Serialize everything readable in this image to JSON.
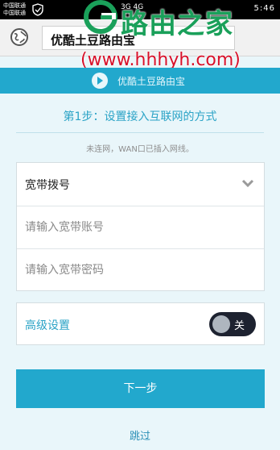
{
  "status_bar": {
    "carrier_1": "中国联通",
    "carrier_2": "中国联通",
    "signal_text": "3G 4G",
    "time_partial": "5:46"
  },
  "browser": {
    "url_text": "优酷土豆路由宝"
  },
  "watermark": {
    "title": "路由之家",
    "url": "(www.hhhyh.com)"
  },
  "header": {
    "title": "优酷土豆路由宝"
  },
  "step": {
    "title": "第1步：设置接入互联网的方式",
    "notice": "未连网，WAN口已插入网线。"
  },
  "form": {
    "connection_type": "宽带拨号",
    "account_placeholder": "请输入宽带账号",
    "password_placeholder": "请输入宽带密码"
  },
  "advanced": {
    "label": "高级设置",
    "toggle_text": "关"
  },
  "actions": {
    "next_label": "下一步",
    "skip_label": "跳过"
  },
  "colors": {
    "accent": "#22a8cd",
    "background": "#e9f6fa",
    "watermark_green": "#1aa05a",
    "watermark_red": "#d8112a"
  }
}
